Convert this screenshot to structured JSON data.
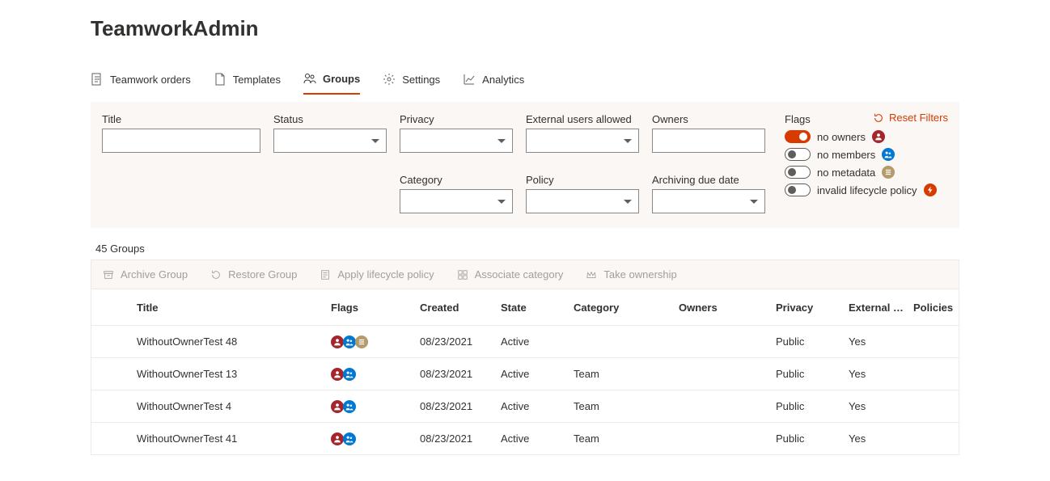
{
  "app_title": "TeamworkAdmin",
  "tabs": [
    {
      "label": "Teamwork orders"
    },
    {
      "label": "Templates"
    },
    {
      "label": "Groups"
    },
    {
      "label": "Settings"
    },
    {
      "label": "Analytics"
    }
  ],
  "active_tab": 2,
  "filters": {
    "title_label": "Title",
    "status_label": "Status",
    "privacy_label": "Privacy",
    "external_label": "External users allowed",
    "owners_label": "Owners",
    "category_label": "Category",
    "policy_label": "Policy",
    "archiving_label": "Archiving due date"
  },
  "flags": {
    "label": "Flags",
    "items": [
      {
        "label": "no owners",
        "on": true,
        "badge_color": "bg-red"
      },
      {
        "label": "no members",
        "on": false,
        "badge_color": "bg-blue"
      },
      {
        "label": "no metadata",
        "on": false,
        "badge_color": "bg-tan"
      },
      {
        "label": "invalid lifecycle policy",
        "on": false,
        "badge_color": "bg-orange"
      }
    ]
  },
  "reset_label": "Reset Filters",
  "count_text": "45 Groups",
  "commands": [
    "Archive Group",
    "Restore Group",
    "Apply lifecycle policy",
    "Associate category",
    "Take ownership"
  ],
  "columns": [
    "Title",
    "Flags",
    "Created",
    "State",
    "Category",
    "Owners",
    "Privacy",
    "External …",
    "Policies"
  ],
  "rows": [
    {
      "title": "WithoutOwnerTest 48",
      "flags": [
        "bg-red",
        "bg-blue",
        "bg-tan"
      ],
      "created": "08/23/2021",
      "state": "Active",
      "category": "",
      "owners": "",
      "privacy": "Public",
      "external": "Yes",
      "policies": ""
    },
    {
      "title": "WithoutOwnerTest 13",
      "flags": [
        "bg-red",
        "bg-blue"
      ],
      "created": "08/23/2021",
      "state": "Active",
      "category": "Team",
      "owners": "",
      "privacy": "Public",
      "external": "Yes",
      "policies": ""
    },
    {
      "title": "WithoutOwnerTest 4",
      "flags": [
        "bg-red",
        "bg-blue"
      ],
      "created": "08/23/2021",
      "state": "Active",
      "category": "Team",
      "owners": "",
      "privacy": "Public",
      "external": "Yes",
      "policies": ""
    },
    {
      "title": "WithoutOwnerTest 41",
      "flags": [
        "bg-red",
        "bg-blue"
      ],
      "created": "08/23/2021",
      "state": "Active",
      "category": "Team",
      "owners": "",
      "privacy": "Public",
      "external": "Yes",
      "policies": ""
    }
  ]
}
